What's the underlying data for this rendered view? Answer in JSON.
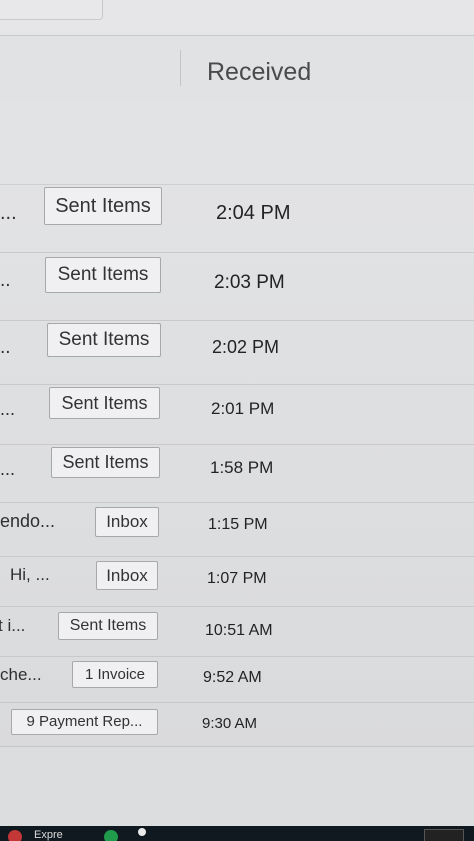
{
  "columns": {
    "received": "Received"
  },
  "messages": [
    {
      "snippet": "...",
      "folder": "Sent Items",
      "received": "2:04 PM"
    },
    {
      "snippet": "..",
      "folder": "Sent Items",
      "received": "2:03 PM"
    },
    {
      "snippet": "..",
      "folder": "Sent Items",
      "received": "2:02 PM"
    },
    {
      "snippet": "...",
      "folder": "Sent Items",
      "received": "2:01 PM"
    },
    {
      "snippet": "...",
      "folder": "Sent Items",
      "received": "1:58 PM"
    },
    {
      "snippet": "endo...",
      "folder": "Inbox",
      "received": "1:15 PM"
    },
    {
      "snippet": "Hi, ...",
      "folder": "Inbox",
      "received": "1:07 PM"
    },
    {
      "snippet": "t i...",
      "folder": "Sent Items",
      "received": "10:51 AM"
    },
    {
      "snippet": "che...",
      "folder": "1 Invoice",
      "received": "9:52 AM"
    },
    {
      "snippet": "",
      "folder": "9 Payment Rep...",
      "received": "9:30 AM"
    }
  ],
  "taskbar": {
    "app_label": "Expre"
  }
}
